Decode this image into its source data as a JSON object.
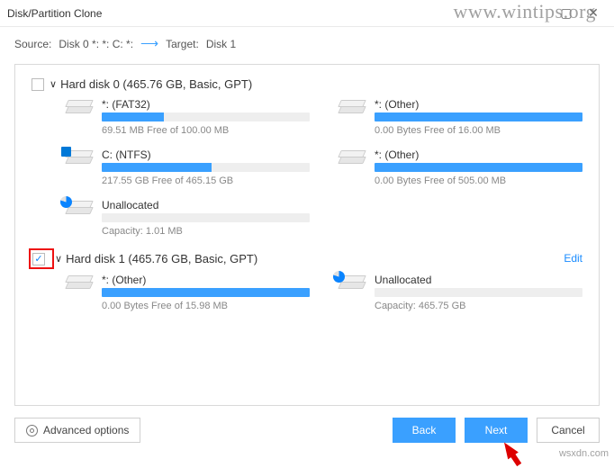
{
  "window": {
    "title": "Disk/Partition Clone"
  },
  "watermark": {
    "top": "www.wintips.org",
    "bottom": "wsxdn.com"
  },
  "path": {
    "sourceLabel": "Source:",
    "sourceValue": "Disk 0 *: *: C: *:",
    "targetLabel": "Target:",
    "targetValue": "Disk 1"
  },
  "disks": [
    {
      "checked": false,
      "highlight": false,
      "title": "Hard disk 0 (465.76 GB, Basic, GPT)",
      "edit": false,
      "parts": [
        {
          "name": "*: (FAT32)",
          "free": "69.51 MB Free of 100.00 MB",
          "fill": 30,
          "icon": "plain"
        },
        {
          "name": "*: (Other)",
          "free": "0.00 Bytes Free of 16.00 MB",
          "fill": 100,
          "icon": "plain"
        },
        {
          "name": "C: (NTFS)",
          "free": "217.55 GB Free of 465.15 GB",
          "fill": 53,
          "icon": "win"
        },
        {
          "name": "*: (Other)",
          "free": "0.00 Bytes Free of 505.00 MB",
          "fill": 100,
          "icon": "plain"
        },
        {
          "name": "Unallocated",
          "free": "Capacity: 1.01 MB",
          "fill": 0,
          "icon": "pie"
        }
      ]
    },
    {
      "checked": true,
      "highlight": true,
      "title": "Hard disk 1 (465.76 GB, Basic, GPT)",
      "edit": true,
      "editLabel": "Edit",
      "parts": [
        {
          "name": "*: (Other)",
          "free": "0.00 Bytes Free of 15.98 MB",
          "fill": 100,
          "icon": "plain"
        },
        {
          "name": "Unallocated",
          "free": "Capacity: 465.75 GB",
          "fill": 0,
          "icon": "pie"
        }
      ]
    }
  ],
  "footer": {
    "advanced": "Advanced options",
    "back": "Back",
    "next": "Next",
    "cancel": "Cancel"
  }
}
